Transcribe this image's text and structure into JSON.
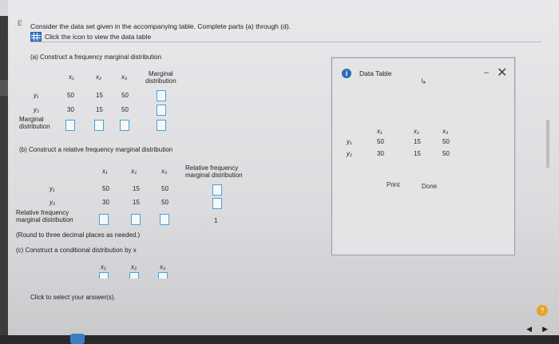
{
  "intro": {
    "text": "Consider the data set given in the accompanying table. Complete parts (a) through (d).",
    "icon_text": "Click the icon to view the data table"
  },
  "part_a": {
    "label": "(a) Construct a frequency marginal distribution",
    "cols": [
      "x₁",
      "x₂",
      "x₃"
    ],
    "marginal_header": [
      "Marginal",
      "distribution"
    ],
    "rows": [
      {
        "label": "y₁",
        "values": [
          "50",
          "15",
          "50"
        ]
      },
      {
        "label": "y₂",
        "values": [
          "30",
          "15",
          "50"
        ]
      }
    ],
    "marginal_row_label": [
      "Marginal",
      "distribution"
    ]
  },
  "part_b": {
    "label": "(b) Construct a relative frequency marginal distribution",
    "cols": [
      "x₁",
      "x₂",
      "x₃"
    ],
    "marginal_header": [
      "Relative frequency",
      "marginal distribution"
    ],
    "rows": [
      {
        "label": "y₁",
        "values": [
          "50",
          "15",
          "50"
        ]
      },
      {
        "label": "y₂",
        "values": [
          "30",
          "15",
          "50"
        ]
      }
    ],
    "marginal_row_label": [
      "Relative frequency",
      "marginal distribution"
    ],
    "total": "1",
    "round_note": "(Round to three decimal places as needed.)"
  },
  "part_c": {
    "label": "(c) Construct a conditional distribution by x",
    "cols": [
      "x₁",
      "x₂",
      "x₃"
    ]
  },
  "footer": "Click to select your answer(s).",
  "data_table": {
    "title": "Data Table",
    "cols": [
      "x₁",
      "x₂",
      "x₃"
    ],
    "rows": [
      {
        "label": "y₁",
        "values": [
          "50",
          "15",
          "50"
        ]
      },
      {
        "label": "y₂",
        "values": [
          "30",
          "15",
          "50"
        ]
      }
    ],
    "print_label": "Print",
    "done_label": "Done",
    "minimize_glyph": "–",
    "close_glyph": "✕"
  },
  "glyphs": {
    "info": "i",
    "help": "?",
    "gear": "⚙",
    "nav_left": "◀",
    "nav_right": "▶",
    "cursor": "↳",
    "e_mark": "E"
  },
  "colors": {
    "accent": "#4aa0d8",
    "info_blue": "#2d6bb8",
    "help_orange": "#e8a323"
  }
}
